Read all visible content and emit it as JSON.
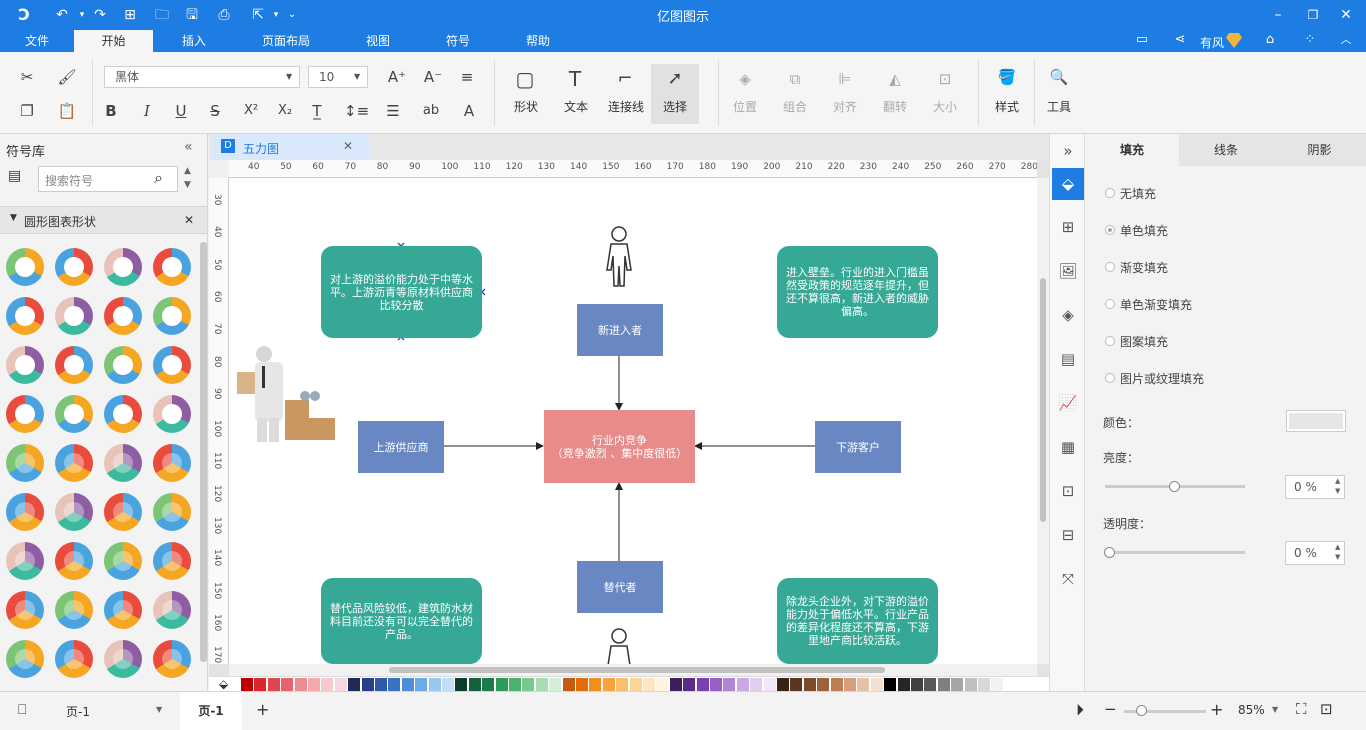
{
  "app": {
    "title": "亿图图示"
  },
  "menus": [
    "文件",
    "开始",
    "插入",
    "页面布局",
    "视图",
    "符号",
    "帮助"
  ],
  "user": {
    "name": "有风"
  },
  "ribbon": {
    "font": "黑体",
    "size": "10",
    "big": {
      "shape": "形状",
      "text": "文本",
      "connector": "连接线",
      "select": "选择"
    },
    "disabled": {
      "position": "位置",
      "group": "组合",
      "align": "对齐",
      "flip": "翻转",
      "size": "大小"
    },
    "style": "样式",
    "tools": "工具"
  },
  "left": {
    "title": "符号库",
    "search_placeholder": "搜索符号",
    "category": "圆形图表形状"
  },
  "doc": {
    "tab": "五力图"
  },
  "ruler": {
    "h": [
      "40",
      "50",
      "60",
      "70",
      "80",
      "90",
      "100",
      "110",
      "120",
      "130",
      "140",
      "150",
      "160",
      "170",
      "180",
      "190",
      "200",
      "210",
      "220",
      "230",
      "240",
      "250",
      "260",
      "270",
      "280"
    ],
    "v": [
      "30",
      "40",
      "50",
      "60",
      "70",
      "80",
      "90",
      "100",
      "110",
      "120",
      "130",
      "140",
      "150",
      "160",
      "170"
    ]
  },
  "diagram": {
    "tl": "对上游的溢价能力处于中等水平。上游沥青等原材料供应商比较分散",
    "tr": "进入壁垒。行业的进入门槛虽然受政策的规范逐年提升，但还不算很高，新进入者的威胁偏高。",
    "bl": "替代品风险较低，建筑防水材料目前还没有可以完全替代的产品。",
    "br": "除龙头企业外，对下游的溢价能力处于偏低水平。行业产品的差异化程度还不算高，下游里地产商比较活跃。",
    "newcomer": "新进入者",
    "center": "行业内竞争\n（竞争激烈 、集中度很低）",
    "supplier": "上游供应商",
    "customer": "下游客户",
    "substitute": "替代者"
  },
  "right": {
    "tabs": [
      "填充",
      "线条",
      "阴影"
    ],
    "options": [
      "无填充",
      "单色填充",
      "渐变填充",
      "单色渐变填充",
      "图案填充",
      "图片或纹理填充"
    ],
    "color_label": "颜色：",
    "brightness_label": "亮度：",
    "brightness_val": "0 %",
    "transparency_label": "透明度：",
    "transparency_val": "0 %"
  },
  "status": {
    "page_select": "页-1",
    "page_tab": "页-1",
    "zoom": "85%"
  },
  "colors": {
    "brand": "#1e7de3",
    "teal": "#36a896",
    "blue": "#6988c3",
    "pink": "#e88b8b"
  }
}
